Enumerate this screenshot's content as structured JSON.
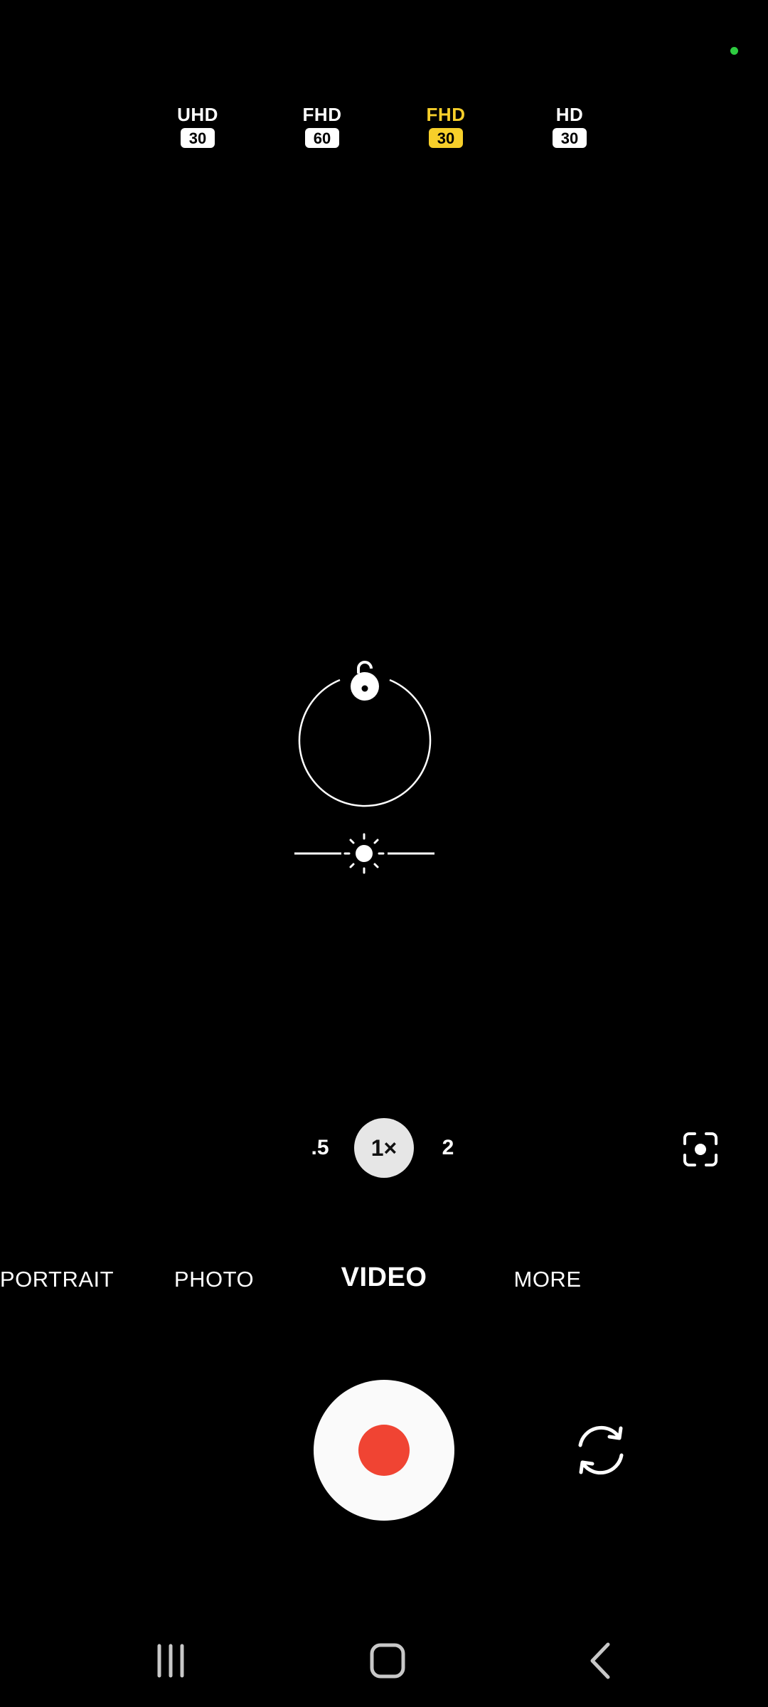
{
  "status": {
    "privacy_indicator_color": "#2ecc40"
  },
  "resolution_options": [
    {
      "label": "UHD",
      "fps": "30",
      "active": false
    },
    {
      "label": "FHD",
      "fps": "60",
      "active": false
    },
    {
      "label": "FHD",
      "fps": "30",
      "active": true
    },
    {
      "label": "HD",
      "fps": "30",
      "active": false
    }
  ],
  "zoom": {
    "options": [
      ".5",
      "1×",
      "2"
    ],
    "selected": "1×"
  },
  "modes": {
    "items": [
      "PORTRAIT",
      "PHOTO",
      "VIDEO",
      "MORE"
    ],
    "selected": "VIDEO"
  },
  "colors": {
    "active_accent": "#f7cf2a",
    "record_button": "#f04433"
  },
  "icons": {
    "focus": "lock-open-icon",
    "exposure": "sun-icon",
    "scene_optimizer": "scene-optimizer-icon",
    "flip_camera": "switch-camera-icon",
    "nav_recents": "recents-icon",
    "nav_home": "home-icon",
    "nav_back": "back-icon"
  }
}
